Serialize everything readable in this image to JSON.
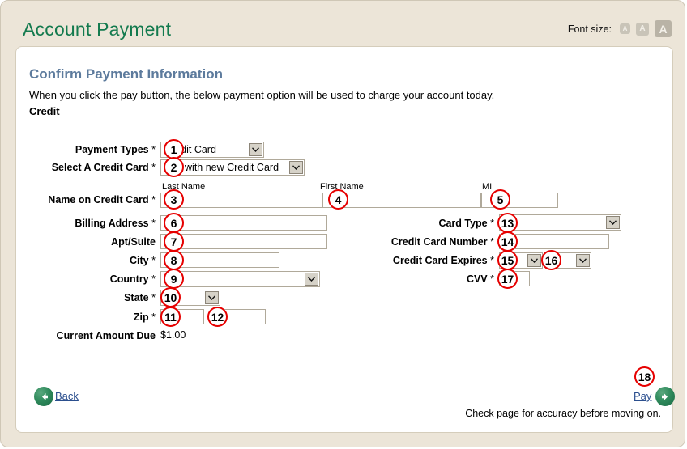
{
  "header": {
    "title": "Account Payment",
    "font_size_label": "Font size:",
    "font_size_options": [
      {
        "label": "A",
        "size": "small"
      },
      {
        "label": "A",
        "size": "medium"
      },
      {
        "label": "A",
        "size": "large",
        "selected": true
      }
    ]
  },
  "card": {
    "section_title": "Confirm Payment Information",
    "intro_text": "When you click the pay button, the below payment option will be used to charge your account today.",
    "credit_text": "Credit"
  },
  "form": {
    "required_mark": "*",
    "fields": {
      "payment_types": {
        "label": "Payment Types",
        "value": "Credit Card",
        "badge": "1"
      },
      "select_credit_card": {
        "label": "Select A Credit Card",
        "value": "Pay with new Credit Card",
        "badge": "2"
      },
      "name_on_card": {
        "label": "Name on Credit Card"
      },
      "last_name": {
        "sublabel": "Last Name",
        "value": "",
        "badge": "3"
      },
      "first_name": {
        "sublabel": "First Name",
        "value": "",
        "badge": "4"
      },
      "mi": {
        "sublabel": "MI",
        "value": "",
        "badge": "5"
      },
      "billing_address": {
        "label": "Billing Address",
        "value": "",
        "badge": "6"
      },
      "apt_suite": {
        "label": "Apt/Suite",
        "value": "",
        "badge": "7"
      },
      "city": {
        "label": "City",
        "value": "",
        "badge": "8"
      },
      "country": {
        "label": "Country",
        "value": "",
        "badge": "9"
      },
      "state": {
        "label": "State",
        "value": "",
        "badge": "10"
      },
      "zip": {
        "label": "Zip",
        "value": "",
        "badge": "11"
      },
      "zip_ext": {
        "value": "",
        "badge": "12"
      },
      "current_amount_due": {
        "label": "Current Amount Due",
        "value": "$1.00"
      },
      "card_type": {
        "label": "Card Type",
        "value": "",
        "badge": "13"
      },
      "credit_card_number": {
        "label": "Credit Card Number",
        "value": "",
        "badge": "14"
      },
      "credit_card_expires": {
        "label": "Credit Card Expires",
        "month_value": "",
        "month_badge": "15",
        "year_value": "",
        "year_badge": "16"
      },
      "cvv": {
        "label": "CVV",
        "value": "",
        "badge": "17"
      }
    }
  },
  "footer": {
    "back_label": "Back",
    "pay_label": "Pay",
    "pay_badge": "18",
    "note": "Check page for accuracy before moving on."
  },
  "colors": {
    "page_background": "#ece5d8",
    "card_background": "#ffffff",
    "title": "#137a4e",
    "section_title": "#5d7b9d",
    "badge_ring": "#e60000",
    "link": "#2b4f8e",
    "nav_arrow": "#2f8a5c"
  }
}
